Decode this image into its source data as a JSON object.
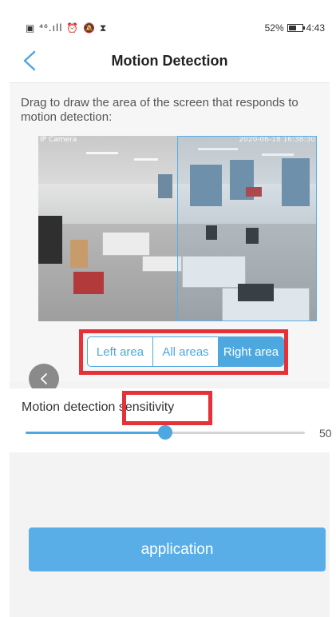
{
  "status_bar": {
    "left_icons": "▣ ⁴⁶.ıll ⏰ 🔕 ⧗",
    "battery_percent": "52%",
    "time": "4:43"
  },
  "header": {
    "title": "Motion Detection",
    "back_icon": "chevron-left-icon"
  },
  "instructions": "Drag to draw the area of the screen that responds to motion detection:",
  "camera": {
    "label": "IP Camera",
    "timestamp": "2020-06-18 16:38:30"
  },
  "area_tabs": {
    "options": [
      "Left area",
      "All areas",
      "Right area"
    ],
    "selected": "Right area"
  },
  "sensitivity": {
    "label": "Motion detection sensitivity",
    "value": 50,
    "max": 100,
    "display_value": "50"
  },
  "apply_label": "application",
  "colors": {
    "accent": "#4ea8e0",
    "highlight_box": "#e53238",
    "button": "#5aaee8"
  }
}
